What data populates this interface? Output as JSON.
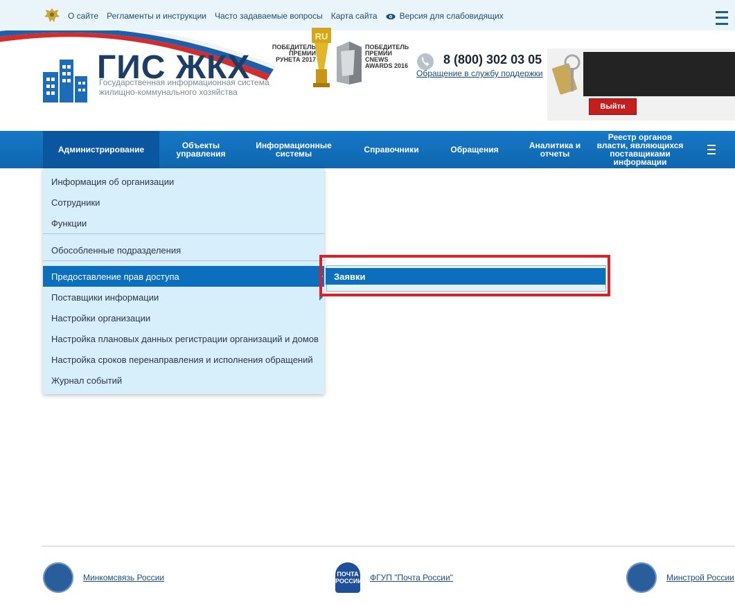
{
  "topbar": {
    "links": [
      "О сайте",
      "Регламенты и инструкции",
      "Часто задаваемые вопросы",
      "Карта сайта",
      "Версия для слабовидящих"
    ]
  },
  "header": {
    "logo_title": "ГИС ЖКХ",
    "logo_subtitle": "Государственная информационная система жилищно-коммунального хозяйства",
    "award1": "ПОБЕДИТЕЛЬ ПРЕМИИ РУНЕТА 2017",
    "award1_badge": "RU",
    "award2": "ПОБЕДИТЕЛЬ ПРЕМИИ CNEWS AWARDS 2016",
    "phone": "8 (800) 302 03 05",
    "support_link": "Обращение в службу поддержки",
    "logout": "Выйти"
  },
  "mainnav": {
    "items": [
      "Администрирование",
      "Объекты управления",
      "Информационные системы",
      "Справочники",
      "Обращения",
      "Аналитика и отчеты",
      "Реестр органов власти, являющихся поставщиками информации"
    ]
  },
  "dropdown": {
    "items": [
      "Информация об организации",
      "Сотрудники",
      "Функции",
      "Обособленные подразделения",
      "Предоставление прав доступа",
      "Поставщики информации",
      "Настройки организации",
      "Настройка плановых данных регистрации организаций и домов",
      "Настройка сроков перенаправления и исполнения обращений",
      "Журнал событий"
    ]
  },
  "submenu": {
    "item": "Заявки"
  },
  "footer": {
    "links": [
      "Минкомсвязь России",
      "ФГУП \"Почта России\"",
      "Минстрой России"
    ],
    "pochta_badge": "ПОЧТА РОССИИ"
  },
  "colors": {
    "nav_blue": "#1678c7",
    "active_blue": "#0b6fbe",
    "highlight_red": "#d9212a",
    "dropdown_bg": "#d7effb"
  }
}
